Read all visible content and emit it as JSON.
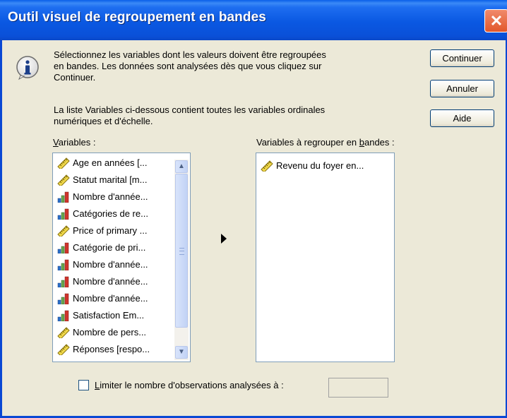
{
  "window": {
    "title": "Outil visuel de regroupement en bandes"
  },
  "info": {
    "line1": "Sélectionnez les variables dont les valeurs doivent être regroupées",
    "line2": "en bandes. Les données sont analysées dès que vous cliquez sur",
    "line3": "Continuer.",
    "line4": "La liste Variables ci-dessous contient toutes les variables ordinales",
    "line5": "numériques et d'échelle."
  },
  "buttons": {
    "continue": "Continuer",
    "cancel": "Annuler",
    "help": "Aide"
  },
  "variables": {
    "label_mnemonic": "V",
    "label_rest": "ariables :",
    "items": [
      {
        "label": "Age en années [...",
        "icon": "scale-ruler-icon"
      },
      {
        "label": "Statut marital [m...",
        "icon": "scale-ruler-icon"
      },
      {
        "label": "Nombre d'année...",
        "icon": "ordinal-bars-icon"
      },
      {
        "label": "Catégories de re...",
        "icon": "ordinal-bars-icon"
      },
      {
        "label": "Price of primary ...",
        "icon": "scale-ruler-icon"
      },
      {
        "label": "Catégorie de pri...",
        "icon": "ordinal-bars-icon"
      },
      {
        "label": "Nombre d'année...",
        "icon": "ordinal-bars-icon"
      },
      {
        "label": "Nombre d'année...",
        "icon": "ordinal-bars-icon"
      },
      {
        "label": "Nombre d'année...",
        "icon": "ordinal-bars-icon"
      },
      {
        "label": "Satisfaction Em...",
        "icon": "ordinal-bars-icon"
      },
      {
        "label": "Nombre de pers...",
        "icon": "scale-ruler-icon"
      },
      {
        "label": "Réponses [respo...",
        "icon": "scale-ruler-icon"
      }
    ]
  },
  "bin_variables": {
    "label_before": "Variables à regrouper en ",
    "label_mnemonic": "b",
    "label_after": "andes :",
    "items": [
      {
        "label": "Revenu du foyer en...",
        "icon": "scale-ruler-icon"
      }
    ]
  },
  "limit": {
    "label_mnemonic": "L",
    "label_rest": "imiter le nombre d'observations analysées à :",
    "checked": false,
    "value": ""
  },
  "colors": {
    "titlebar": "#0a58e2",
    "dialog_bg": "#ece9d8",
    "close_button": "#e2572b",
    "list_border": "#7f9db9"
  }
}
